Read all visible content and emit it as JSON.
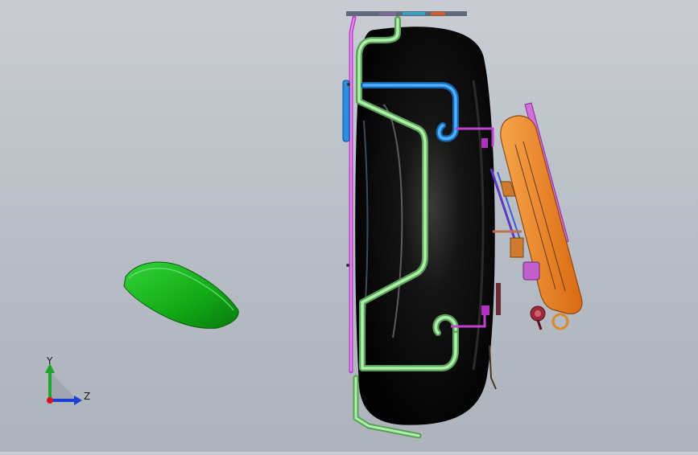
{
  "viewport": {
    "background_top": "#c9cdd3",
    "background_bottom": "#aeb3bb"
  },
  "triad": {
    "y_label": "Y",
    "z_label": "Z",
    "y_color": "#1fa52b",
    "z_color": "#1a3fd6",
    "x_color": "#d9151b"
  },
  "model": {
    "tire_color": "#0b0b0b",
    "pipe_green": "#9fe0a0",
    "pipe_blue": "#2a8fe0",
    "pipe_magenta": "#c040d0",
    "bracket_orange": "#f08a2a",
    "pad_green": "#1fb01f"
  }
}
